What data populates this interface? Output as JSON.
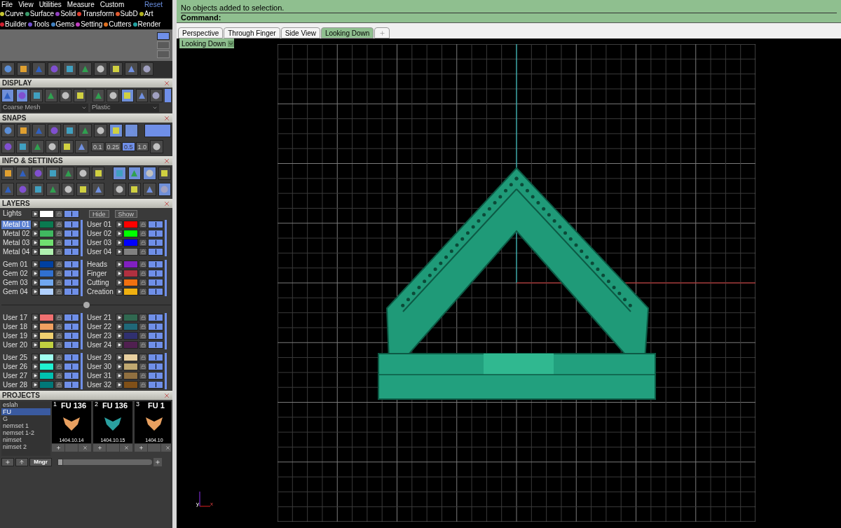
{
  "menu": [
    "File",
    "View",
    "Utilities",
    "Measure",
    "Custom"
  ],
  "reset": "Reset",
  "modules": [
    {
      "label": "Curve",
      "color": "#c8c832"
    },
    {
      "label": "Surface",
      "color": "#3a9a6a"
    },
    {
      "label": "Solid",
      "color": "#9040c0"
    },
    {
      "label": "Transform",
      "color": "#e04030"
    },
    {
      "label": "SubD",
      "color": "#e05a30"
    },
    {
      "label": "Art",
      "color": "#b0b020"
    },
    {
      "label": "Builder",
      "color": "#d02030"
    },
    {
      "label": "Tools",
      "color": "#7050d0"
    },
    {
      "label": "Gems",
      "color": "#4080c0"
    },
    {
      "label": "Setting",
      "color": "#c040c0"
    },
    {
      "label": "Cutters",
      "color": "#e07020"
    },
    {
      "label": "Render",
      "color": "#20a0a0"
    }
  ],
  "display": {
    "title": "DISPLAY",
    "mesh": "Coarse Mesh",
    "material": "Plastic"
  },
  "snaps": {
    "title": "SNAPS",
    "on": true,
    "values": [
      {
        "label": "0.1",
        "selected": false
      },
      {
        "label": "0.25",
        "selected": false
      },
      {
        "label": "0.5",
        "selected": true
      },
      {
        "label": "1.0",
        "selected": false
      }
    ]
  },
  "info": {
    "title": "INFO & SETTINGS"
  },
  "layers": {
    "title": "LAYERS",
    "lights": {
      "name": "Lights",
      "color": "#ffffff",
      "selected": false,
      "visible": true
    },
    "hide": "Hide",
    "show": "Show",
    "groups": [
      {
        "layers": [
          {
            "name": "Metal 01",
            "color": "#0a7a50",
            "selected": true,
            "visible": true
          },
          {
            "name": "Metal 02",
            "color": "#40b860",
            "selected": false,
            "visible": true
          },
          {
            "name": "Metal 03",
            "color": "#70e070",
            "selected": false,
            "visible": true
          },
          {
            "name": "Metal 04",
            "color": "#b0f0b0",
            "selected": false,
            "visible": true
          }
        ]
      },
      {
        "layers": [
          {
            "name": "User 01",
            "color": "#ff0000",
            "selected": false,
            "visible": true
          },
          {
            "name": "User 02",
            "color": "#00ff00",
            "selected": false,
            "visible": true
          },
          {
            "name": "User 03",
            "color": "#0000ff",
            "selected": false,
            "visible": true
          },
          {
            "name": "User 04",
            "color": "#808080",
            "selected": false,
            "visible": true
          }
        ]
      },
      {
        "layers": [
          {
            "name": "Gem 01",
            "color": "#0040a0",
            "selected": false,
            "visible": true
          },
          {
            "name": "Gem 02",
            "color": "#3070d0",
            "selected": false,
            "visible": true
          },
          {
            "name": "Gem 03",
            "color": "#70a8f0",
            "selected": false,
            "visible": true
          },
          {
            "name": "Gem 04",
            "color": "#b0d0ff",
            "selected": false,
            "visible": true
          }
        ]
      },
      {
        "layers": [
          {
            "name": "Heads",
            "color": "#8020c0",
            "selected": false,
            "visible": true
          },
          {
            "name": "Finger",
            "color": "#b03040",
            "selected": false,
            "visible": true
          },
          {
            "name": "Cutting",
            "color": "#f07010",
            "selected": false,
            "visible": true
          },
          {
            "name": "Creation",
            "color": "#f0b010",
            "selected": false,
            "visible": true
          }
        ]
      },
      {
        "layers": [
          {
            "name": "User 17",
            "color": "#f07070",
            "selected": false,
            "visible": true
          },
          {
            "name": "User 18",
            "color": "#f0a060",
            "selected": false,
            "visible": true
          },
          {
            "name": "User 19",
            "color": "#f0d070",
            "selected": false,
            "visible": true
          },
          {
            "name": "User 20",
            "color": "#c0d040",
            "selected": false,
            "visible": true
          }
        ]
      },
      {
        "layers": [
          {
            "name": "User 21",
            "color": "#306850",
            "selected": false,
            "visible": true
          },
          {
            "name": "User 22",
            "color": "#206878",
            "selected": false,
            "visible": true
          },
          {
            "name": "User 23",
            "color": "#303070",
            "selected": false,
            "visible": true
          },
          {
            "name": "User 24",
            "color": "#502050",
            "selected": false,
            "visible": true
          }
        ]
      },
      {
        "layers": [
          {
            "name": "User 25",
            "color": "#a0fff0",
            "selected": false,
            "visible": true
          },
          {
            "name": "User 26",
            "color": "#20f0d0",
            "selected": false,
            "visible": true
          },
          {
            "name": "User 27",
            "color": "#00c0b0",
            "selected": false,
            "visible": true
          },
          {
            "name": "User 28",
            "color": "#007878",
            "selected": false,
            "visible": true
          }
        ]
      },
      {
        "layers": [
          {
            "name": "User 29",
            "color": "#e8d0a0",
            "selected": false,
            "visible": true
          },
          {
            "name": "User 30",
            "color": "#c0a870",
            "selected": false,
            "visible": true
          },
          {
            "name": "User 31",
            "color": "#907040",
            "selected": false,
            "visible": true
          },
          {
            "name": "User 32",
            "color": "#805018",
            "selected": false,
            "visible": true
          }
        ]
      }
    ]
  },
  "projects": {
    "title": "PROJECTS",
    "items": [
      {
        "label": "eslah",
        "selected": false
      },
      {
        "label": "FU",
        "selected": true
      },
      {
        "label": "G",
        "selected": false
      },
      {
        "label": "nemset 1",
        "selected": false
      },
      {
        "label": "nemset 1-2",
        "selected": false
      },
      {
        "label": "nimset",
        "selected": false
      },
      {
        "label": "nimset 2",
        "selected": false
      }
    ],
    "thumbnails": [
      {
        "number": "1",
        "title": "FU 136",
        "date": "1404.10.14"
      },
      {
        "number": "2",
        "title": "FU 136",
        "date": "1404.10.15"
      },
      {
        "number": "3",
        "title": "FU 1",
        "date": "1404.10"
      }
    ],
    "manager": "Mngr",
    "thumbnail_size": {
      "level": 0
    }
  },
  "command": {
    "lines": [
      "No objects added to selection."
    ],
    "prompt": "Command:"
  },
  "view_tabs": [
    {
      "label": "Perspective",
      "selected": false
    },
    {
      "label": "Through Finger",
      "selected": false
    },
    {
      "label": "Side View",
      "selected": false
    },
    {
      "label": "Looking Down",
      "selected": true
    }
  ],
  "viewport": {
    "label": "Looking Down",
    "axis_x": "x",
    "axis_y": "y"
  }
}
